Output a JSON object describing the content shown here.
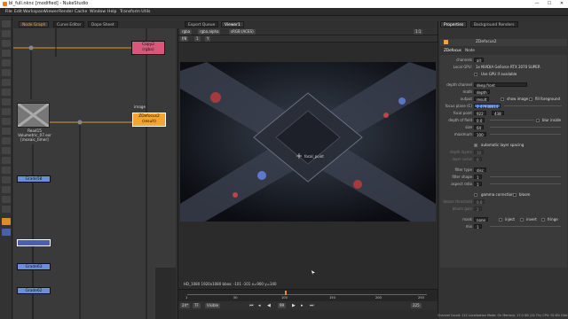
{
  "window": {
    "title": "bl_full.nknc [modified] - NukeStudio",
    "minimize": "—",
    "maximize": "☐",
    "close": "✕"
  },
  "menus": [
    "File",
    "Edit",
    "Workspace",
    "Viewer",
    "Render",
    "Cache",
    "Window",
    "Help",
    "Transform Utils"
  ],
  "left_tabs": [
    "Node Graph",
    "Curve Editor",
    "Dope Sheet"
  ],
  "viewer_tabs": [
    "Export Queue",
    "Viewer1"
  ],
  "viewer_controls": {
    "channels": "rgba",
    "layer": "rgba.alpha",
    "colorspace": "sRGB (ACES)",
    "zoom": "1:1",
    "frame_label": "f/8",
    "frame": "1",
    "y": "Y"
  },
  "viewer_overlay": {
    "node_label": "focal_point"
  },
  "viewer_info": "HD_1080 1920x1080  bbox: -101 -101  x=900 y=340",
  "timeline": {
    "fps": "24*",
    "mode": "TF",
    "visible": "Visible",
    "ticks": [
      "1",
      "50",
      "100",
      "150",
      "200",
      "250"
    ],
    "current_frame": "225",
    "end": "252",
    "marker": "99"
  },
  "nodes": {
    "copy": {
      "title": "Copy2",
      "sub": "(rgba)"
    },
    "read": {
      "title": "Read15",
      "sub": "Volumetric_07.exr",
      "extra": "[mosaic_timer]"
    },
    "zdefocus": {
      "title": "ZDefocus2",
      "sub": "(result)"
    },
    "image_label": "image",
    "grades": [
      "Grade58",
      "Grade63",
      "Grade62"
    ],
    "selected": ""
  },
  "properties": {
    "tabs": [
      "Properties",
      "Background Renders"
    ],
    "node_name": "ZDefocus2",
    "node_tabs": [
      "ZDefocus",
      "Node"
    ],
    "rows": [
      {
        "label": "channels",
        "value": "all"
      },
      {
        "label": "Local GPU:",
        "value": "1x NVIDIA GeForce RTX 2070 SUPER"
      },
      {
        "label": "",
        "value": "Use GPU if available"
      },
      {
        "label": "depth channel",
        "value": "deep.front"
      },
      {
        "label": "math",
        "value": "depth"
      },
      {
        "label": "output",
        "value": "result",
        "extra": "show image",
        "extra2": "fill foreground"
      },
      {
        "label": "focus plane (C)",
        "value": "0.47938814"
      },
      {
        "label": "focal point",
        "value": "922",
        "value2": "438"
      },
      {
        "label": "depth of field",
        "value": "0.0",
        "extra": "blur inside"
      },
      {
        "label": "size",
        "value": "64"
      },
      {
        "label": "maximum",
        "value": "100"
      },
      {
        "label": "",
        "value": "automatic layer spacing"
      },
      {
        "label": "depth layers",
        "value": "10"
      },
      {
        "label": "layer curve",
        "value": "0"
      },
      {
        "label": "filter type",
        "value": "disc"
      },
      {
        "label": "filter shape",
        "value": "1"
      },
      {
        "label": "aspect ratio",
        "value": "1"
      },
      {
        "label": "",
        "value": "gamma correction",
        "extra": "bloom"
      },
      {
        "label": "bloom threshold",
        "value": "0.8"
      },
      {
        "label": "bloom gain",
        "value": "2"
      },
      {
        "label": "mask",
        "value": "none",
        "extra": "inject",
        "extra2": "invert",
        "extra3": "fringe"
      },
      {
        "label": "mix",
        "value": "1"
      }
    ]
  },
  "status": "Channel Count: 112  Localisation Mode: On  Memory: 17.0 GB (13.7%)  CPU: 92.8%  Disk: 0.0 MB/s  Network: 0.0 MB/s",
  "colors": {
    "accent": "#e87d1e",
    "node_orange": "#f5a331",
    "node_pink": "#d8577a",
    "node_blue": "#6a8fd6",
    "timeline_marker": "#f08a24"
  }
}
